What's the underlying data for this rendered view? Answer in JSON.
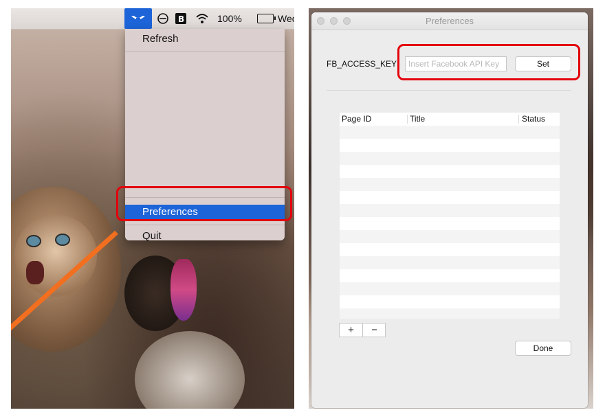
{
  "menubar": {
    "battery_text": "100%",
    "clock_partial": "Wec",
    "icons": [
      "app-status-icon",
      "do-not-disturb-icon",
      "b-app-icon",
      "wifi-icon",
      "battery-icon"
    ]
  },
  "menu": {
    "items": [
      "Refresh",
      "Preferences",
      "Quit"
    ],
    "selected": "Preferences"
  },
  "window": {
    "title": "Preferences",
    "access_key_label": "FB_ACCESS_KEY",
    "access_key_value": "",
    "access_key_placeholder": "Insert Facebook API Key",
    "set_label": "Set",
    "table": {
      "columns": [
        "Page ID",
        "Title",
        "Status"
      ]
    },
    "add_label": "+",
    "remove_label": "−",
    "done_label": "Done"
  },
  "colors": {
    "accent": "#1c64d8",
    "highlight": "#e3000b"
  }
}
